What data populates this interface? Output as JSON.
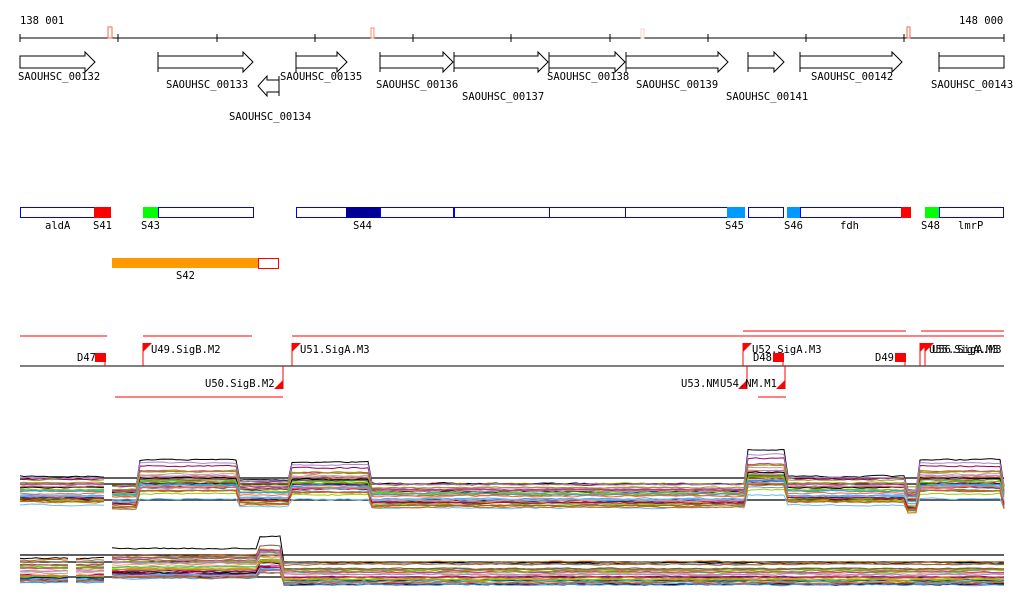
{
  "ruler": {
    "start_label": "138 001",
    "end_label": "148 000"
  },
  "genes": [
    {
      "label": "SAOUHSC_00132",
      "strand": "+"
    },
    {
      "label": "SAOUHSC_00133",
      "strand": "+"
    },
    {
      "label": "SAOUHSC_00134",
      "strand": "-"
    },
    {
      "label": "SAOUHSC_00135",
      "strand": "+"
    },
    {
      "label": "SAOUHSC_00136",
      "strand": "+"
    },
    {
      "label": "SAOUHSC_00137",
      "strand": "+"
    },
    {
      "label": "SAOUHSC_00138",
      "strand": "+"
    },
    {
      "label": "SAOUHSC_00139",
      "strand": "+"
    },
    {
      "label": "SAOUHSC_00141",
      "strand": "+"
    },
    {
      "label": "SAOUHSC_00142",
      "strand": "+"
    },
    {
      "label": "SAOUHSC_00143",
      "strand": "none"
    }
  ],
  "features": {
    "labels": [
      "aldA",
      "S41",
      "S43",
      "S44",
      "S45",
      "S46",
      "fdh",
      "S48",
      "lmrP"
    ],
    "s42_label": "S42",
    "colors": {
      "gene_border": "#0000ff",
      "red": "#ff0000",
      "green": "#00ff00",
      "navy": "#000099",
      "blue": "#0099ff",
      "orange": "#ff9900"
    }
  },
  "promoters": {
    "labels": [
      "D47",
      "U49.SigB.M2",
      "U50.SigB.M2",
      "U51.SigA.M3",
      "U52.SigA.M3",
      "D48",
      "U53.NM",
      "U54.NM.M1",
      "D49",
      "U55.SigA.M3",
      "U56.SigA.M3"
    ],
    "color": "#ff0000"
  },
  "expression": {
    "palette": [
      "#000000",
      "#66bbff",
      "#cc9999",
      "#990066",
      "#66cc00",
      "#996633",
      "#ff6633",
      "#cc3399",
      "#999900",
      "#3399ff",
      "#cc6600",
      "#aa88cc",
      "#33cc33",
      "#ff9966",
      "#003366",
      "#996666",
      "#99cc00",
      "#cc0033",
      "#6699cc",
      "#885544"
    ]
  }
}
